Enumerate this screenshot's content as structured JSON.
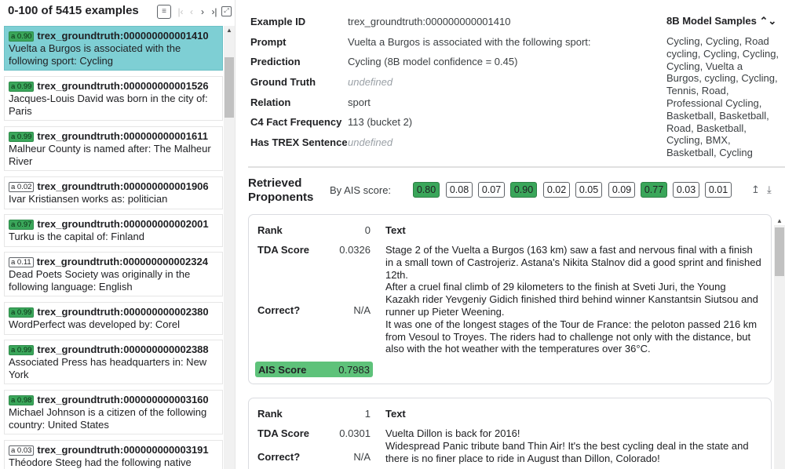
{
  "header": {
    "count_title": "0-100 of 5415 examples",
    "icons": [
      "list-icon",
      "first-page-icon",
      "prev-page-icon",
      "next-page-icon",
      "last-page-icon",
      "fit-icon"
    ]
  },
  "examples": [
    {
      "score": "a 0.90",
      "id": "trex_groundtruth:000000000001410",
      "text": "Vuelta a Burgos is associated with the following sport: Cycling",
      "selected": true,
      "badge_green": true
    },
    {
      "score": "a 0.99",
      "id": "trex_groundtruth:000000000001526",
      "text": "Jacques-Louis David was born in the city of: Paris",
      "selected": false,
      "badge_green": true
    },
    {
      "score": "a 0.99",
      "id": "trex_groundtruth:000000000001611",
      "text": "Malheur County is named after: The Malheur River",
      "selected": false,
      "badge_green": true
    },
    {
      "score": "a 0.02",
      "id": "trex_groundtruth:000000000001906",
      "text": "Ivar Kristiansen works as: politician",
      "selected": false,
      "badge_green": false
    },
    {
      "score": "a 0.97",
      "id": "trex_groundtruth:000000000002001",
      "text": "Turku is the capital of: Finland",
      "selected": false,
      "badge_green": true
    },
    {
      "score": "a 0.11",
      "id": "trex_groundtruth:000000000002324",
      "text": "Dead Poets Society was originally in the following language: English",
      "selected": false,
      "badge_green": false
    },
    {
      "score": "a 0.99",
      "id": "trex_groundtruth:000000000002380",
      "text": "WordPerfect was developed by: Corel",
      "selected": false,
      "badge_green": true
    },
    {
      "score": "a 0.99",
      "id": "trex_groundtruth:000000000002388",
      "text": "Associated Press has headquarters in: New York",
      "selected": false,
      "badge_green": true
    },
    {
      "score": "a 0.98",
      "id": "trex_groundtruth:000000000003160",
      "text": "Michael Johnson is a citizen of the following country: United States",
      "selected": false,
      "badge_green": true
    },
    {
      "score": "a 0.03",
      "id": "trex_groundtruth:000000000003191",
      "text": "Théodore Steeg had the following native",
      "selected": false,
      "badge_green": false
    }
  ],
  "details": {
    "example_id_label": "Example ID",
    "example_id": "trex_groundtruth:000000000001410",
    "prompt_label": "Prompt",
    "prompt": "Vuelta a Burgos is associated with the following sport:",
    "prediction_label": "Prediction",
    "prediction": "Cycling (8B model confidence = 0.45)",
    "ground_truth_label": "Ground Truth",
    "ground_truth": "undefined",
    "relation_label": "Relation",
    "relation": "sport",
    "c4_label": "C4 Fact Frequency",
    "c4": "113 (bucket 2)",
    "trex_label": "Has TREX Sentence",
    "trex": "undefined"
  },
  "samples": {
    "title": "8B Model Samples ⌃⌄",
    "text": "Cycling, Cycling, Road cycling, Cycling, Cycling, Cycling, Vuelta a Burgos, cycling, Cycling, Tennis, Road, Professional Cycling, Basketball, Basketball, Road, Basketball, Cycling, BMX, Basketball, Cycling"
  },
  "proponents": {
    "title": "Retrieved Proponents",
    "ais_label": "By AIS score:",
    "scores": [
      {
        "value": "0.80",
        "high": true
      },
      {
        "value": "0.08",
        "high": false
      },
      {
        "value": "0.07",
        "high": false
      },
      {
        "value": "0.90",
        "high": true
      },
      {
        "value": "0.02",
        "high": false
      },
      {
        "value": "0.05",
        "high": false
      },
      {
        "value": "0.09",
        "high": false
      },
      {
        "value": "0.77",
        "high": true
      },
      {
        "value": "0.03",
        "high": false
      },
      {
        "value": "0.01",
        "high": false
      }
    ],
    "expand_icon": "↥",
    "download_icon": "⤓"
  },
  "cards": [
    {
      "rank_label": "Rank",
      "rank": "0",
      "tda_label": "TDA Score",
      "tda": "0.0326",
      "correct_label": "Correct?",
      "correct": "N/A",
      "text_label": "Text",
      "text": "Stage 2 of the Vuelta a Burgos (163 km) saw a fast and nervous final with a finish in a small town of Castrojeriz. Astana's Nikita Stalnov did a good sprint and finished 12th.\nAfter a cruel final climb of 29 kilometers to the finish at Sveti Juri, the Young Kazakh rider Yevgeniy Gidich finished third behind winner Kanstantsin Siutsou and runner up Pieter Weening.\nIt was one of the longest stages of the Tour de France: the peloton passed 216 km from Vesoul to Troyes. The riders had to challenge not only with the distance, but also with the hot weather with the temperatures over 36°C.",
      "ais_label": "AIS Score",
      "ais": "0.7983"
    },
    {
      "rank_label": "Rank",
      "rank": "1",
      "tda_label": "TDA Score",
      "tda": "0.0301",
      "correct_label": "Correct?",
      "correct": "N/A",
      "text_label": "Text",
      "text": "Vuelta Dillon is back for 2016!\nWidespread Panic tribute band Thin Air! It's the best cycling deal in the state and there is no finer place to ride in August than Dillon, Colorado!"
    }
  ],
  "colors": {
    "selected": "#7ecfd4",
    "badge_green": "#3aa65a",
    "ais_box": "#5ec27a"
  }
}
